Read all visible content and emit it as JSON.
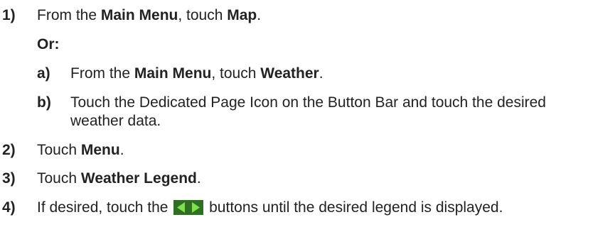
{
  "steps": [
    {
      "num": "1)",
      "text": [
        "From the ",
        "Main Menu",
        ", touch ",
        "Map",
        "."
      ]
    },
    {
      "or_label": "Or:"
    },
    {
      "num": "a)",
      "text": [
        "From the ",
        "Main Menu",
        ", touch ",
        "Weather",
        "."
      ]
    },
    {
      "num": "b)",
      "text": [
        "Touch the Dedicated Page Icon on the Button Bar and touch the desired",
        "weather data."
      ]
    },
    {
      "num": "2)",
      "text": [
        "Touch ",
        "Menu",
        "."
      ]
    },
    {
      "num": "3)",
      "text": [
        "Touch ",
        "Weather Legend",
        "."
      ]
    },
    {
      "num": "4)",
      "text": [
        "If desired, touch the ",
        " buttons until the desired legend is displayed."
      ]
    }
  ],
  "icons": {
    "arrows": "left-right-arrow-buttons-icon",
    "bg": "#2e6f23",
    "arrow": "#7ee04a"
  }
}
